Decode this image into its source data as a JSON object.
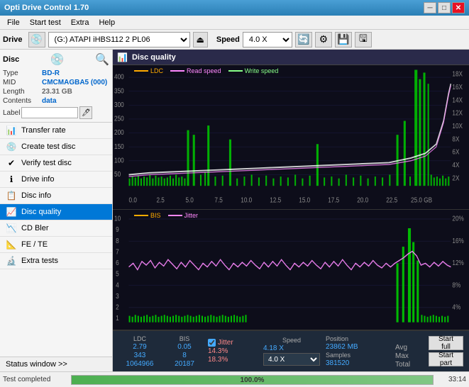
{
  "window": {
    "title": "Opti Drive Control 1.70",
    "minimize": "─",
    "maximize": "□",
    "close": "✕"
  },
  "menu": {
    "items": [
      "File",
      "Start test",
      "Extra",
      "Help"
    ]
  },
  "toolbar": {
    "drive_label": "Drive",
    "drive_value": "(G:) ATAPI iHBS112  2 PL06",
    "speed_label": "Speed",
    "speed_value": "4.0 X"
  },
  "disc": {
    "title": "Disc",
    "type_label": "Type",
    "type_value": "BD-R",
    "mid_label": "MID",
    "mid_value": "CMCMAGBA5 (000)",
    "length_label": "Length",
    "length_value": "23.31 GB",
    "contents_label": "Contents",
    "contents_value": "data",
    "label_label": "Label",
    "label_value": ""
  },
  "nav": {
    "items": [
      {
        "id": "transfer-rate",
        "label": "Transfer rate",
        "icon": "📊"
      },
      {
        "id": "create-test-disc",
        "label": "Create test disc",
        "icon": "💿"
      },
      {
        "id": "verify-test-disc",
        "label": "Verify test disc",
        "icon": "✔"
      },
      {
        "id": "drive-info",
        "label": "Drive info",
        "icon": "ℹ"
      },
      {
        "id": "disc-info",
        "label": "Disc info",
        "icon": "📋"
      },
      {
        "id": "disc-quality",
        "label": "Disc quality",
        "icon": "📈",
        "active": true
      },
      {
        "id": "cd-bler",
        "label": "CD Bler",
        "icon": "📉"
      },
      {
        "id": "fe-te",
        "label": "FE / TE",
        "icon": "📐"
      },
      {
        "id": "extra-tests",
        "label": "Extra tests",
        "icon": "🔬"
      }
    ]
  },
  "status_window": "Status window >>",
  "chart": {
    "title": "Disc quality",
    "legend": {
      "ldc": "LDC",
      "read_speed": "Read speed",
      "write_speed": "Write speed"
    },
    "legend2": {
      "bis": "BIS",
      "jitter": "Jitter"
    },
    "y_axis_top": [
      "400",
      "350",
      "300",
      "250",
      "200",
      "150",
      "100",
      "50"
    ],
    "y_axis_top_right": [
      "18X",
      "16X",
      "14X",
      "12X",
      "10X",
      "8X",
      "6X",
      "4X",
      "2X"
    ],
    "x_axis": [
      "0.0",
      "2.5",
      "5.0",
      "7.5",
      "10.0",
      "12.5",
      "15.0",
      "17.5",
      "20.0",
      "22.5",
      "25.0 GB"
    ],
    "y_axis_bot": [
      "10",
      "9",
      "8",
      "7",
      "6",
      "5",
      "4",
      "3",
      "2",
      "1"
    ],
    "y_axis_bot_right": [
      "20%",
      "16%",
      "12%",
      "8%",
      "4%"
    ]
  },
  "stats": {
    "ldc_header": "LDC",
    "bis_header": "BIS",
    "jitter_header": "Jitter",
    "speed_header": "Speed",
    "avg_label": "Avg",
    "max_label": "Max",
    "total_label": "Total",
    "ldc_avg": "2.79",
    "ldc_max": "343",
    "ldc_total": "1064966",
    "bis_avg": "0.05",
    "bis_max": "8",
    "bis_total": "20187",
    "jitter_avg": "14.3%",
    "jitter_max": "18.3%",
    "jitter_total": "",
    "speed_val": "4.18 X",
    "speed_select": "4.0 X",
    "position_label": "Position",
    "position_val": "23862 MB",
    "samples_label": "Samples",
    "samples_val": "381520"
  },
  "buttons": {
    "start_full": "Start full",
    "start_part": "Start part"
  },
  "progress": {
    "label": "Test completed",
    "percent": 100,
    "percent_text": "100.0%",
    "time": "33:14"
  }
}
